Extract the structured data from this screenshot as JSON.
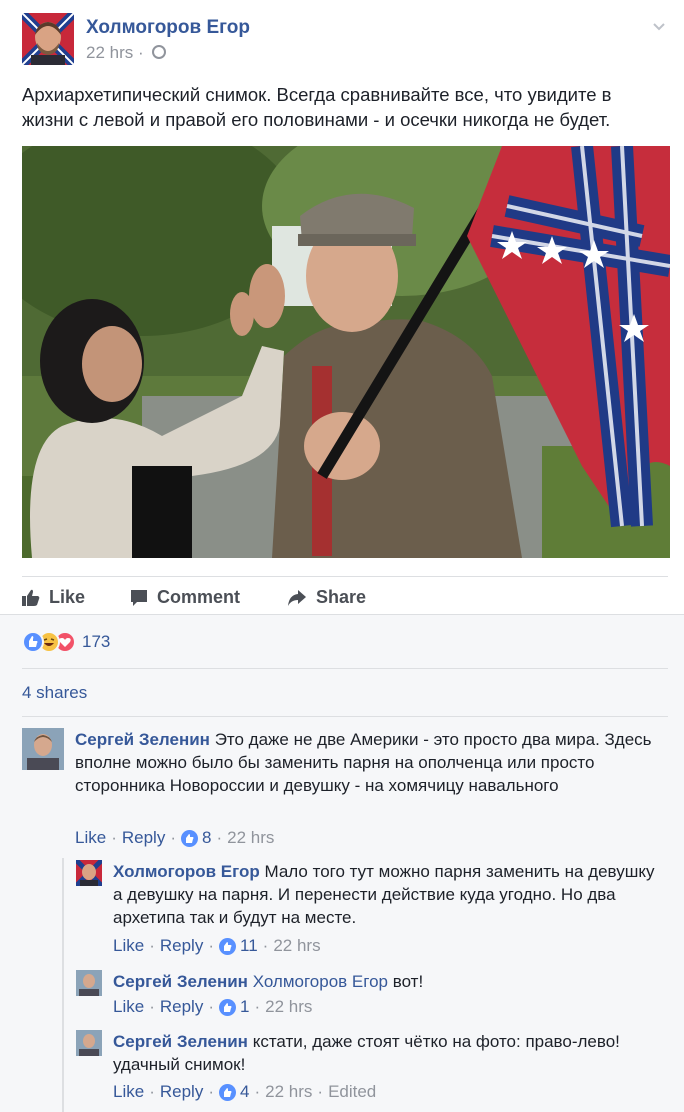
{
  "post": {
    "author": "Холмогоров Егор",
    "time": "22 hrs",
    "text": "Архиархетипический снимок. Всегда сравнивайте все, что увидите в жизни с левой и правой его половинами - и осечки никогда не будет."
  },
  "actions": {
    "like": "Like",
    "comment": "Comment",
    "share": "Share"
  },
  "reactions": {
    "count": "173",
    "types": [
      "like",
      "haha",
      "love"
    ]
  },
  "shares": "4 shares",
  "comments": [
    {
      "author": "Сергей Зеленин",
      "text": "Это даже не две Америки - это просто два мира. Здесь вполне можно было бы заменить парня на ополченца или просто сторонника Новороссии и девушку - на хомячицу навального",
      "like": "Like",
      "reply": "Reply",
      "likes": "8",
      "time": "22 hrs",
      "replies": [
        {
          "author": "Холмогоров Егор",
          "text": "Мало того тут можно парня заменить на девушку а девушку на парня. И перенести действие куда угодно. Но два архетипа так и будут на месте.",
          "like": "Like",
          "reply": "Reply",
          "likes": "11",
          "time": "22 hrs"
        },
        {
          "author": "Сергей Зеленин",
          "tag": "Холмогоров Егор",
          "text": "вот!",
          "like": "Like",
          "reply": "Reply",
          "likes": "1",
          "time": "22 hrs"
        },
        {
          "author": "Сергей Зеленин",
          "text": "кстати, даже стоят чётко на фото: право-лево! удачный снимок!",
          "like": "Like",
          "reply": "Reply",
          "likes": "4",
          "time": "22 hrs",
          "edited": "Edited"
        }
      ]
    }
  ],
  "colors": {
    "link": "#365899",
    "meta": "#90949c",
    "like_blue": "#5890ff",
    "love_red": "#f25268",
    "haha_yellow": "#f7c244"
  }
}
